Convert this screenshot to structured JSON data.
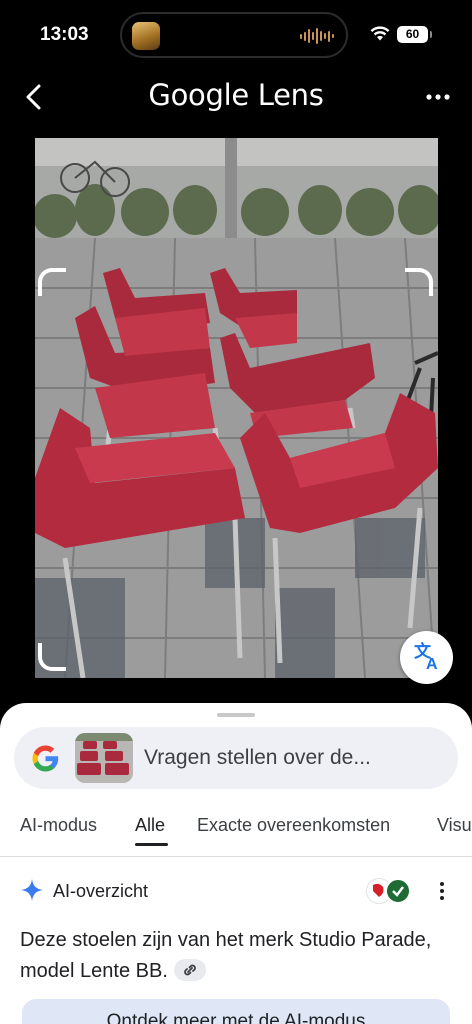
{
  "status_bar": {
    "time": "13:03",
    "battery": "60"
  },
  "header": {
    "title": "Google Lens"
  },
  "search": {
    "placeholder": "Vragen stellen over de..."
  },
  "tabs": [
    {
      "label": "AI-modus"
    },
    {
      "label": "Alle",
      "active": true
    },
    {
      "label": "Exacte overeenkomsten"
    },
    {
      "label": "Visu"
    }
  ],
  "ai_overview": {
    "title": "AI-overzicht",
    "text": "Deze stoelen zijn van het merk Studio Parade, model Lente BB.",
    "cta": "Ontdek meer met de AI-modus"
  },
  "colors": {
    "accent": "#202124",
    "chair_red": "#b0283a",
    "sheet_bg": "#ffffff",
    "search_bg": "#eef0f5",
    "cta_bg": "#dfe7f6"
  }
}
